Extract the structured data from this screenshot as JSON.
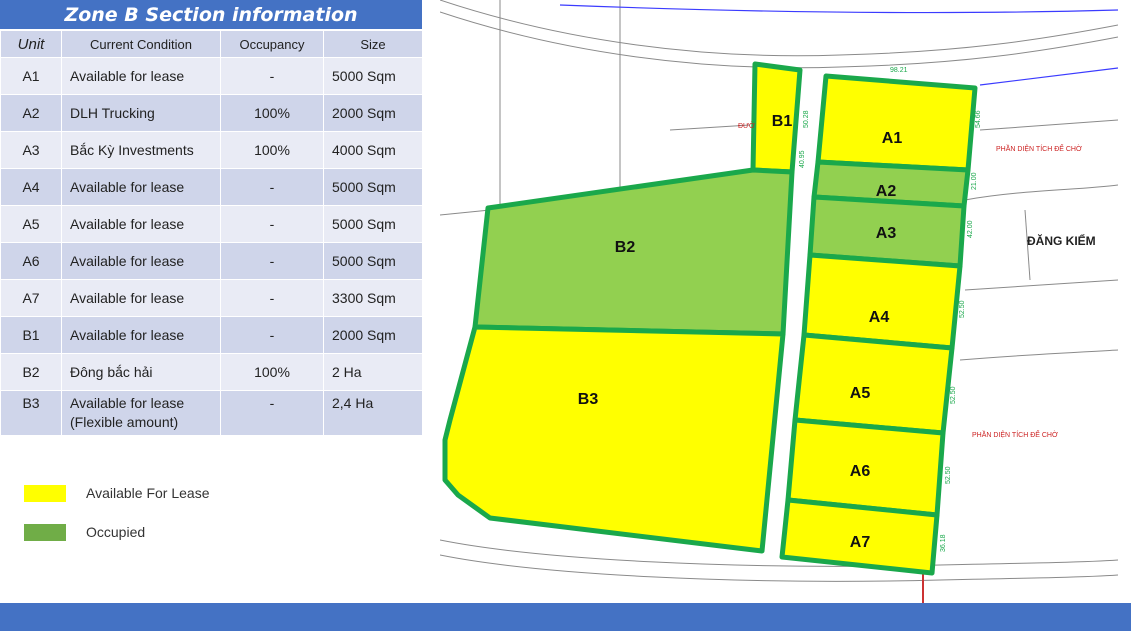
{
  "title": "Zone B Section information",
  "table": {
    "headers": [
      "Unit",
      "Current Condition",
      "Occupancy",
      "Size"
    ],
    "rows": [
      {
        "unit": "A1",
        "condition": "Available for lease",
        "occupancy": "-",
        "size": "5000 Sqm"
      },
      {
        "unit": "A2",
        "condition": "DLH Trucking",
        "occupancy": "100%",
        "size": "2000 Sqm"
      },
      {
        "unit": "A3",
        "condition": "Bắc Kỳ Investments",
        "occupancy": "100%",
        "size": "4000 Sqm"
      },
      {
        "unit": "A4",
        "condition": "Available for lease",
        "occupancy": "-",
        "size": "5000 Sqm"
      },
      {
        "unit": "A5",
        "condition": "Available for lease",
        "occupancy": "-",
        "size": "5000 Sqm"
      },
      {
        "unit": "A6",
        "condition": "Available for lease",
        "occupancy": "-",
        "size": "5000 Sqm"
      },
      {
        "unit": "A7",
        "condition": "Available for lease",
        "occupancy": "-",
        "size": "3300 Sqm"
      },
      {
        "unit": "B1",
        "condition": "Available for lease",
        "occupancy": "-",
        "size": "2000 Sqm"
      },
      {
        "unit": "B2",
        "condition": "Đông bắc hải",
        "occupancy": "100%",
        "size": "2 Ha"
      },
      {
        "unit": "B3",
        "condition": "Available for lease",
        "condition2": "(Flexible amount)",
        "occupancy": "-",
        "size": "2,4 Ha"
      }
    ]
  },
  "legend": {
    "available": {
      "label": "Available For Lease",
      "color": "#ffff00"
    },
    "occupied": {
      "label": "Occupied",
      "color": "#70ad47"
    }
  },
  "colors": {
    "header_blue": "#4472c4",
    "row_light": "#e9ebf5",
    "row_dark": "#cfd5ea",
    "plot_yellow": "#ffff00",
    "plot_green": "#92d050",
    "plot_border": "#1aa84b"
  },
  "map": {
    "plots": {
      "A1": "A1",
      "A2": "A2",
      "A3": "A3",
      "A4": "A4",
      "A5": "A5",
      "A6": "A6",
      "A7": "A7",
      "B1": "B1",
      "B2": "B2",
      "B3": "B3"
    },
    "labels": {
      "dang_kiem": "ĐĂNG KIỂM",
      "phan_dien_1": "PHẦN DIỆN TÍCH ĐỂ CHỜ",
      "phan_dien_2": "PHẦN DIỆN TÍCH ĐỂ CHỜ",
      "duong": "ĐƯỜ",
      "dim_top": "98.21",
      "dim_1": "54.66",
      "dim_2": "21.00",
      "dim_3": "42.00",
      "dim_4": "52.50",
      "dim_5": "52.50",
      "dim_6": "52.50",
      "dim_7": "36.18",
      "dim_b1a": "50.28",
      "dim_b1b": "40.95"
    }
  }
}
